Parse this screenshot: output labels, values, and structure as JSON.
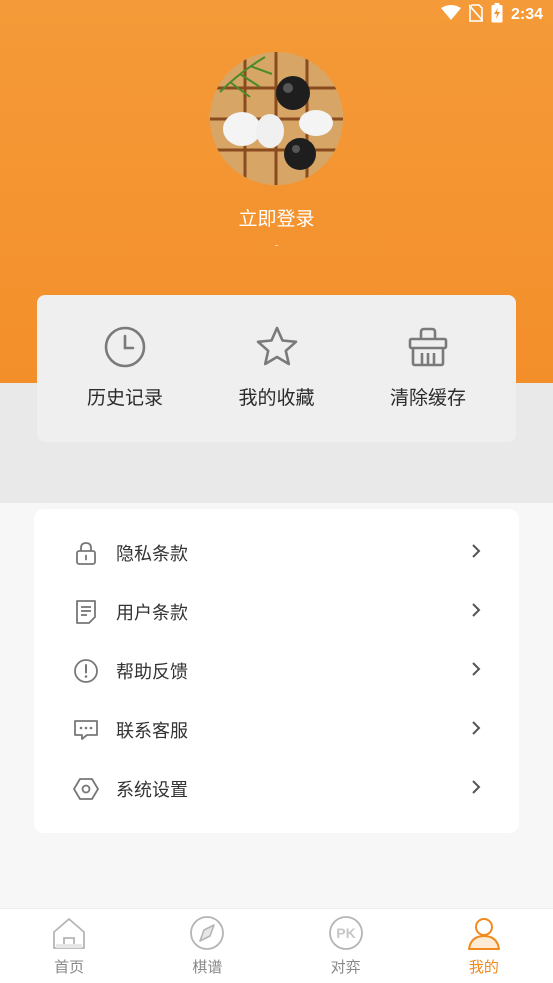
{
  "status_bar": {
    "time": "2:34"
  },
  "profile": {
    "login_label": "立即登录",
    "subtitle": "-"
  },
  "quick_actions": [
    {
      "label": "历史记录",
      "icon": "clock-icon"
    },
    {
      "label": "我的收藏",
      "icon": "star-icon"
    },
    {
      "label": "清除缓存",
      "icon": "basket-icon"
    }
  ],
  "menu": [
    {
      "label": "隐私条款",
      "icon": "lock-icon"
    },
    {
      "label": "用户条款",
      "icon": "document-icon"
    },
    {
      "label": "帮助反馈",
      "icon": "exclamation-icon"
    },
    {
      "label": "联系客服",
      "icon": "chat-icon"
    },
    {
      "label": "系统设置",
      "icon": "settings-hex-icon"
    }
  ],
  "tabs": [
    {
      "label": "首页",
      "icon": "home-icon",
      "active": false
    },
    {
      "label": "棋谱",
      "icon": "compass-icon",
      "active": false
    },
    {
      "label": "对弈",
      "icon": "pk-icon",
      "active": false
    },
    {
      "label": "我的",
      "icon": "user-icon",
      "active": true
    }
  ],
  "colors": {
    "accent": "#f39228",
    "tab_active": "#f08a1c",
    "tab_inactive": "#b5b5b5"
  }
}
